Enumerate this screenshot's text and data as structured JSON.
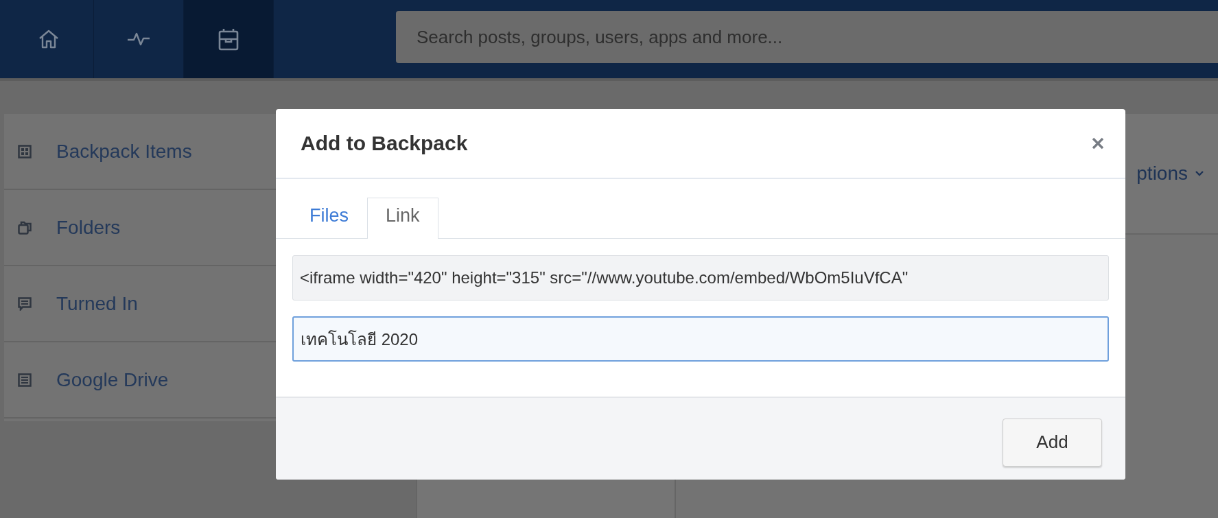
{
  "top_nav": [
    {
      "kind": "home",
      "selected": false
    },
    {
      "kind": "activity",
      "selected": false
    },
    {
      "kind": "backpack",
      "selected": true
    }
  ],
  "search": {
    "placeholder": "Search posts, groups, users, apps and more..."
  },
  "sidebar": {
    "items": [
      {
        "kind": "grid",
        "label": "Backpack Items"
      },
      {
        "kind": "folders",
        "label": "Folders"
      },
      {
        "kind": "comment",
        "label": "Turned In"
      },
      {
        "kind": "document",
        "label": "Google Drive"
      }
    ]
  },
  "options_link": "ptions",
  "dialog": {
    "title": "Add to Backpack",
    "tabs": [
      {
        "label": "Files",
        "selected": false
      },
      {
        "label": "Link",
        "selected": true
      }
    ],
    "embed_code": "<iframe width=\"420\" height=\"315\" src=\"//www.youtube.com/embed/WbOm5IuVfCA\"",
    "link_title": "เทคโนโลยี 2020",
    "add_button": "Add"
  }
}
